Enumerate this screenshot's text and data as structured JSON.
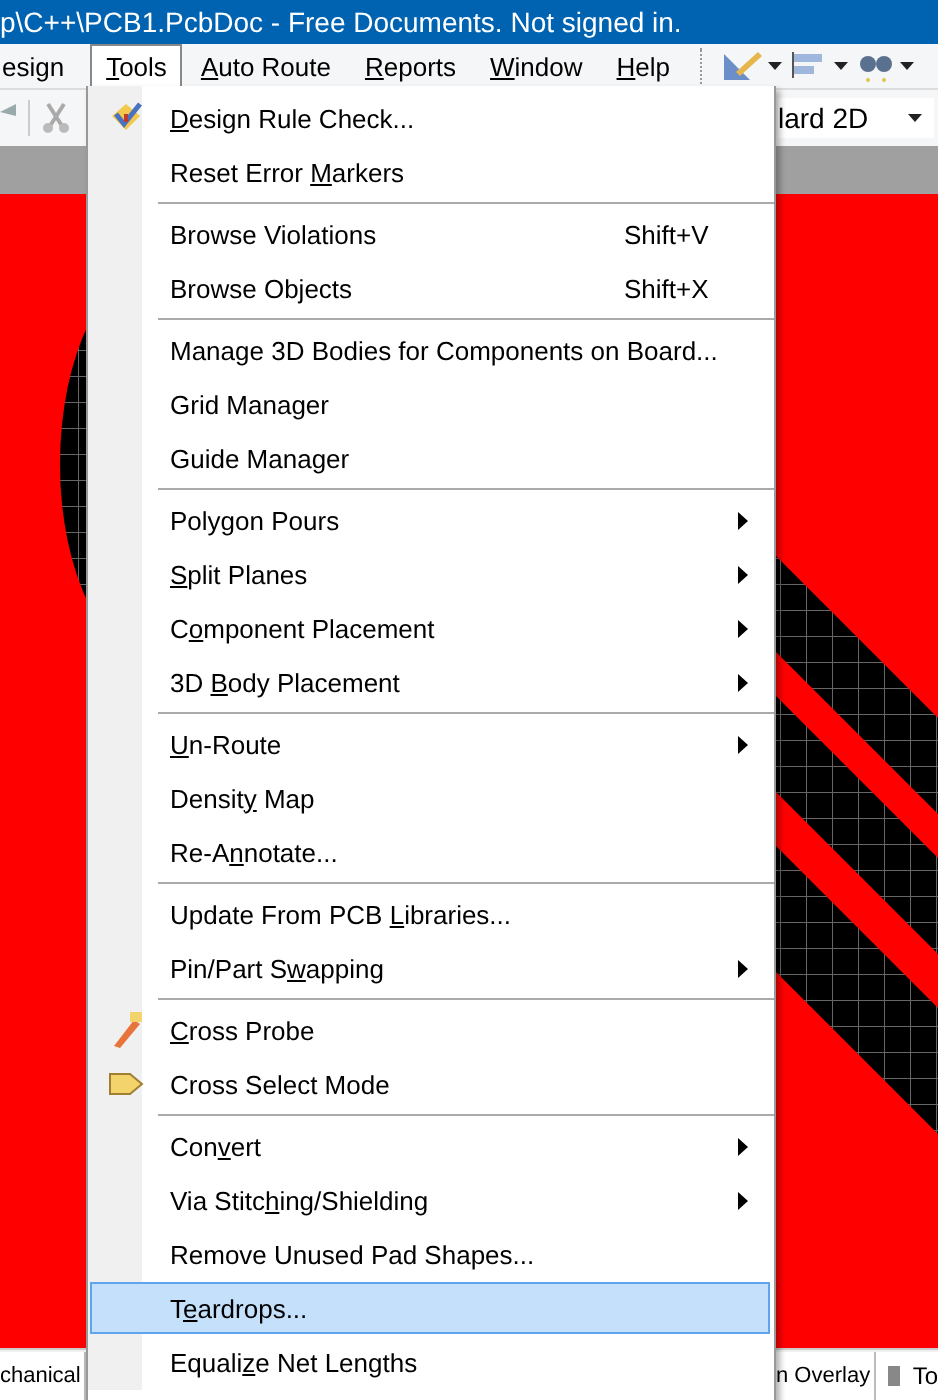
{
  "window": {
    "title": "p\\C++\\PCB1.PcbDoc - Free Documents. Not signed in."
  },
  "menu_bar": [
    {
      "label": {
        "post": "esign"
      },
      "selected": false
    },
    {
      "label": {
        "key": "T",
        "post": "ools"
      },
      "selected": true
    },
    {
      "label": {
        "key": "A",
        "post": "uto Route"
      },
      "selected": false
    },
    {
      "label": {
        "key": "R",
        "post": "eports"
      },
      "selected": false
    },
    {
      "label": {
        "key": "W",
        "post": "indow"
      },
      "selected": false
    },
    {
      "label": {
        "key": "H",
        "post": "elp"
      },
      "selected": false
    }
  ],
  "toolbar": {
    "view_dropdown": "lard 2D"
  },
  "tools_menu": [
    {
      "kind": "item",
      "label": {
        "key": "D",
        "post": "esign Rule Check..."
      },
      "submenu": false,
      "selected": false
    },
    {
      "kind": "item",
      "label": {
        "pre": "Reset Error ",
        "key": "M",
        "post": "arkers"
      },
      "submenu": false,
      "selected": false
    },
    {
      "kind": "separator"
    },
    {
      "kind": "item",
      "label": {
        "pre": "Browse Violations"
      },
      "shortcut": "Shift+V",
      "submenu": false,
      "selected": false
    },
    {
      "kind": "item",
      "label": {
        "pre": "Browse Objects"
      },
      "shortcut": "Shift+X",
      "submenu": false,
      "selected": false
    },
    {
      "kind": "separator"
    },
    {
      "kind": "item",
      "label": {
        "pre": "Manage 3D Bodies for Components on Board..."
      },
      "submenu": false,
      "selected": false
    },
    {
      "kind": "item",
      "label": {
        "pre": "Grid Manager"
      },
      "submenu": false,
      "selected": false
    },
    {
      "kind": "item",
      "label": {
        "pre": "Guide Manager"
      },
      "submenu": false,
      "selected": false
    },
    {
      "kind": "separator"
    },
    {
      "kind": "item",
      "label": {
        "pre": "Poly",
        "key": "g",
        "post": "on Pours"
      },
      "submenu": true,
      "selected": false
    },
    {
      "kind": "item",
      "label": {
        "key": "S",
        "post": "plit Planes"
      },
      "submenu": true,
      "selected": false
    },
    {
      "kind": "item",
      "label": {
        "pre": "C",
        "key": "o",
        "post": "mponent Placement"
      },
      "submenu": true,
      "selected": false
    },
    {
      "kind": "item",
      "label": {
        "pre": "3D ",
        "key": "B",
        "post": "ody Placement"
      },
      "submenu": true,
      "selected": false
    },
    {
      "kind": "separator"
    },
    {
      "kind": "item",
      "label": {
        "key": "U",
        "post": "n-Route"
      },
      "submenu": true,
      "selected": false
    },
    {
      "kind": "item",
      "label": {
        "pre": "Densit",
        "key": "y",
        "post": " Map"
      },
      "submenu": false,
      "selected": false
    },
    {
      "kind": "item",
      "label": {
        "pre": "Re-A",
        "key": "n",
        "post": "notate..."
      },
      "submenu": false,
      "selected": false
    },
    {
      "kind": "separator"
    },
    {
      "kind": "item",
      "label": {
        "pre": "Update From PCB ",
        "key": "L",
        "post": "ibraries..."
      },
      "submenu": false,
      "selected": false
    },
    {
      "kind": "item",
      "label": {
        "pre": "Pin/Part S",
        "key": "w",
        "post": "apping"
      },
      "submenu": true,
      "selected": false
    },
    {
      "kind": "separator"
    },
    {
      "kind": "item",
      "label": {
        "key": "C",
        "post": "ross Probe"
      },
      "submenu": false,
      "selected": false
    },
    {
      "kind": "item",
      "label": {
        "pre": "Cross Select Mode"
      },
      "submenu": false,
      "selected": false
    },
    {
      "kind": "separator"
    },
    {
      "kind": "item",
      "label": {
        "pre": "Con",
        "key": "v",
        "post": "ert"
      },
      "submenu": true,
      "selected": false
    },
    {
      "kind": "item",
      "label": {
        "pre": "Via Stitc",
        "key": "h",
        "post": "ing/Shielding"
      },
      "submenu": true,
      "selected": false
    },
    {
      "kind": "item",
      "label": {
        "pre": "Remove Unused Pad Shapes..."
      },
      "submenu": false,
      "selected": false
    },
    {
      "kind": "item",
      "label": {
        "pre": "T",
        "key": "e",
        "post": "ardrops..."
      },
      "submenu": false,
      "selected": true
    },
    {
      "kind": "item",
      "label": {
        "pre": "Equali",
        "key": "z",
        "post": "e Net Lengths"
      },
      "submenu": false,
      "selected": false
    }
  ],
  "layer_tabs": [
    {
      "label": "chanical"
    },
    {
      "label": "n Overlay"
    },
    {
      "label": "To"
    }
  ]
}
